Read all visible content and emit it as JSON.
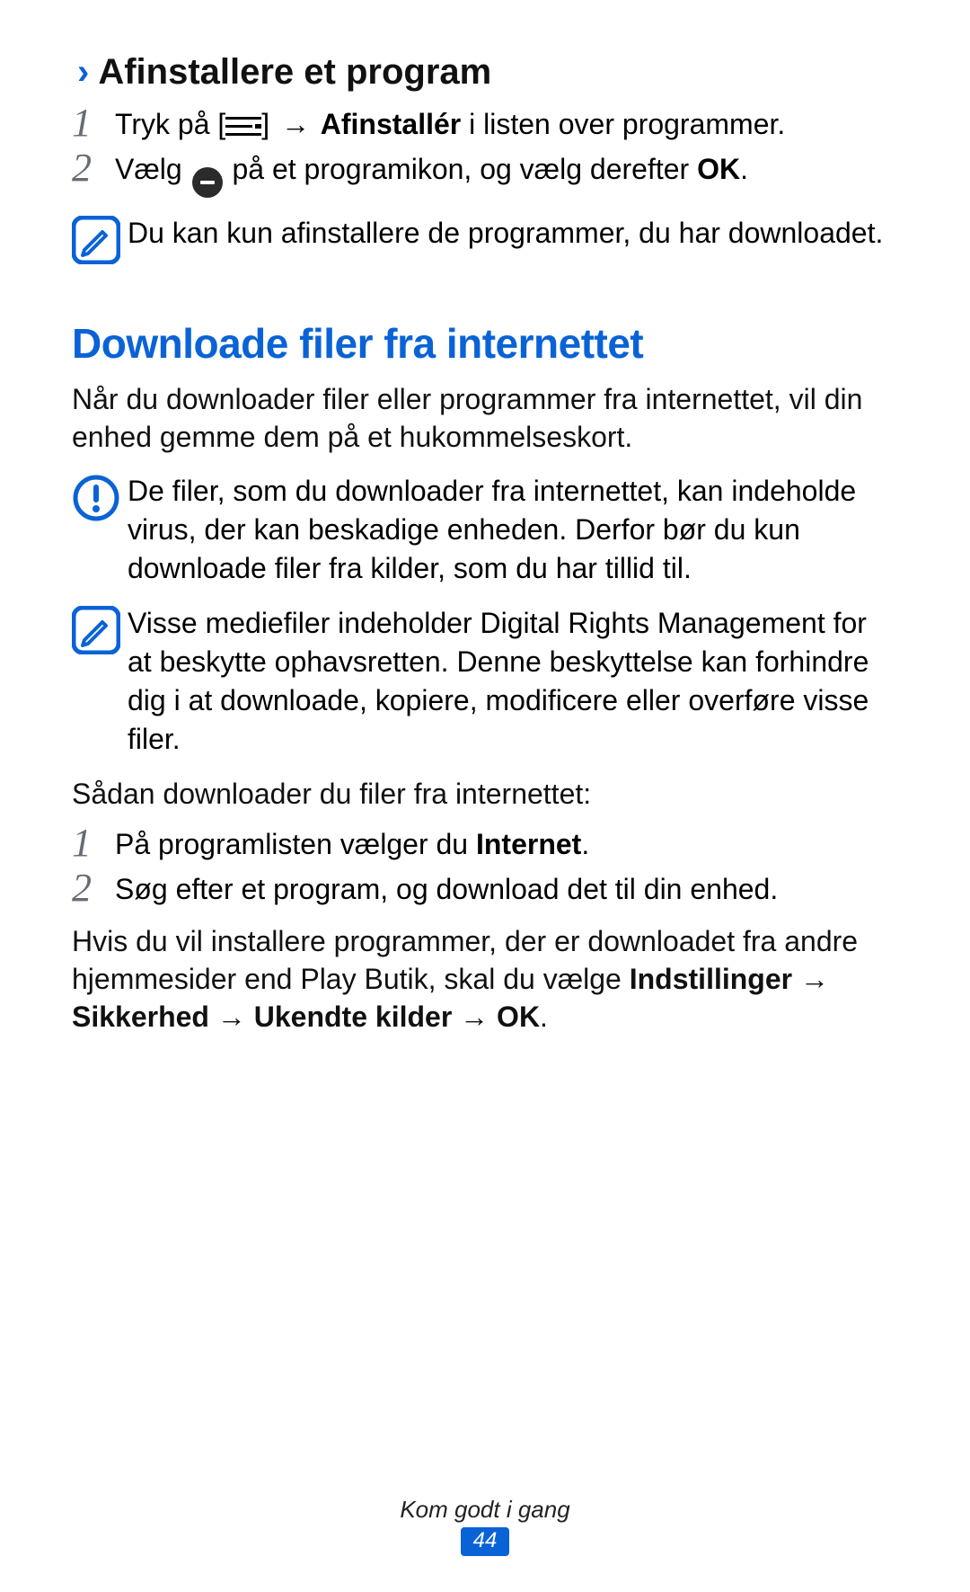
{
  "section1": {
    "title": "Afinstallere et program",
    "steps": [
      {
        "prefix": "Tryk på [",
        "icon": "menu",
        "mid": "] ",
        "arrow": "→",
        "bold": " Afinstallér",
        "suffix": " i listen over programmer."
      },
      {
        "prefix": "Vælg ",
        "icon": "minus",
        "mid": " på et programikon, og vælg derefter ",
        "bold": "OK",
        "suffix": "."
      }
    ],
    "note": "Du kan kun afinstallere de programmer, du har downloadet."
  },
  "section2": {
    "title": "Downloade filer fra internettet",
    "intro": "Når du downloader filer eller programmer fra internettet, vil din enhed gemme dem på et hukommelseskort.",
    "warning": "De filer, som du downloader fra internettet, kan indeholde virus, der kan beskadige enheden. Derfor bør du kun downloade filer fra kilder, som du har tillid til.",
    "note": "Visse mediefiler indeholder Digital Rights Management for at beskytte ophavsretten. Denne beskyttelse kan forhindre dig i at downloade, kopiere, modificere eller overføre visse filer.",
    "howto": "Sådan downloader du filer fra internettet:",
    "steps": [
      {
        "prefix": "På programlisten vælger du ",
        "bold": "Internet",
        "suffix": "."
      },
      {
        "text": "Søg efter et program, og download det til din enhed."
      }
    ],
    "outro_pre": "Hvis du vil installere programmer, der er downloadet fra andre hjemmesider end Play Butik, skal du vælge ",
    "outro_b1": "Indstillinger",
    "outro_arrow": " → ",
    "outro_b2": "Sikkerhed",
    "outro_b3": "Ukendte kilder",
    "outro_b4": "OK",
    "outro_period": "."
  },
  "footer": {
    "section": "Kom godt i gang",
    "page": "44"
  }
}
